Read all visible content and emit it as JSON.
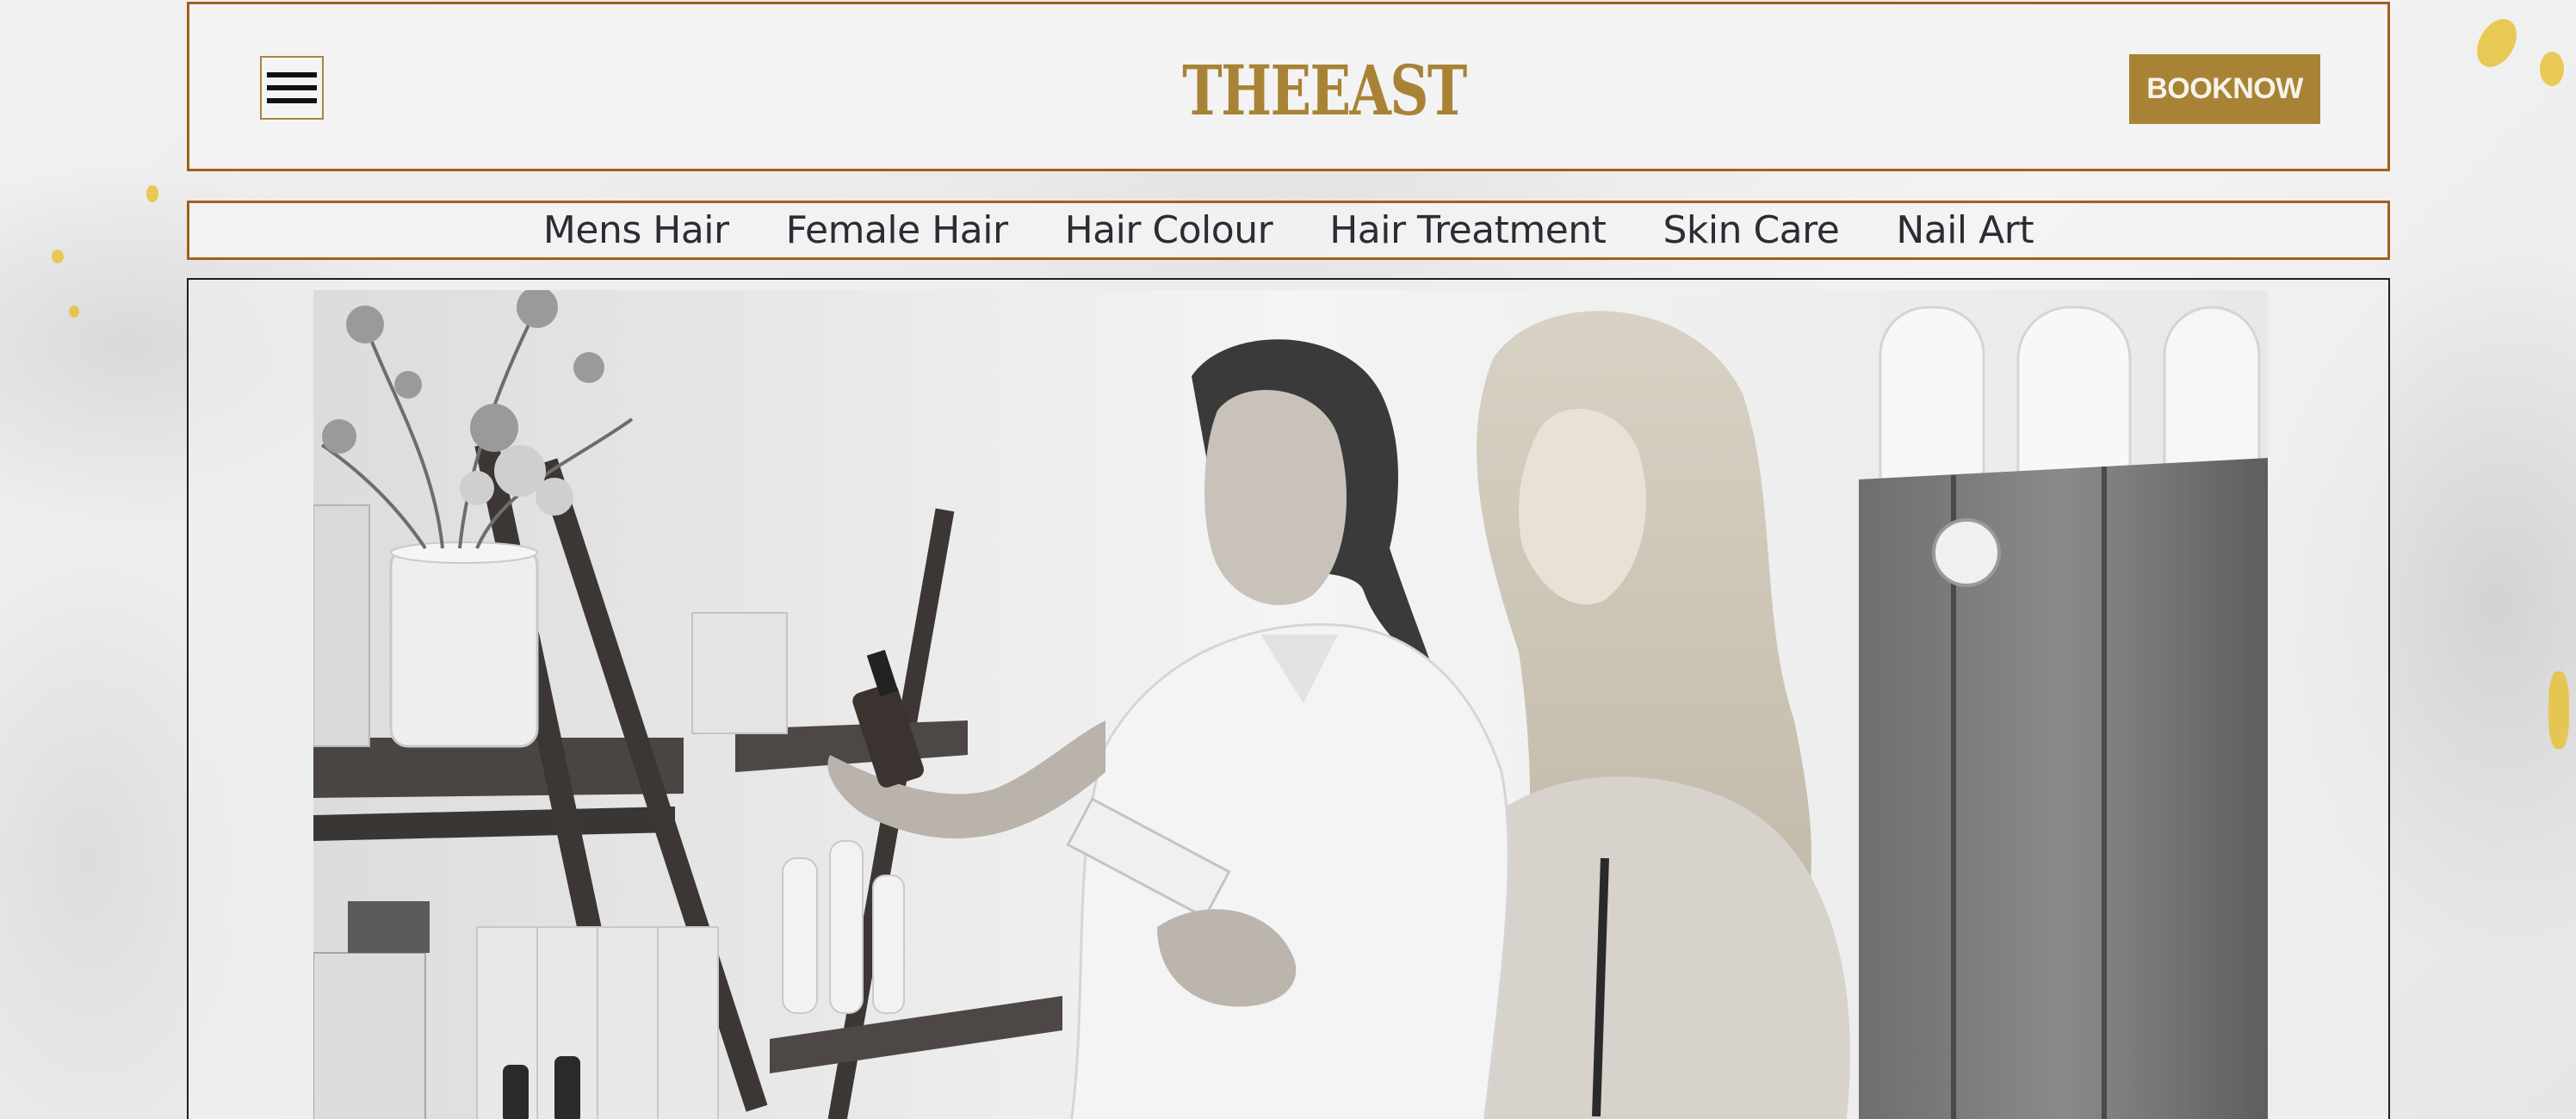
{
  "header": {
    "logo": "THEEAST",
    "book_label": "BOOKNOW",
    "menu_icon": "hamburger-icon"
  },
  "nav": {
    "items": [
      {
        "label": "Mens Hair"
      },
      {
        "label": "Female Hair"
      },
      {
        "label": "Hair Colour"
      },
      {
        "label": "Hair Treatment"
      },
      {
        "label": "Skin Care"
      },
      {
        "label": "Nail Art"
      }
    ]
  },
  "colors": {
    "accent_gold": "#a88336",
    "border_brown": "#a0601c",
    "nav_text": "#2a2e34"
  }
}
